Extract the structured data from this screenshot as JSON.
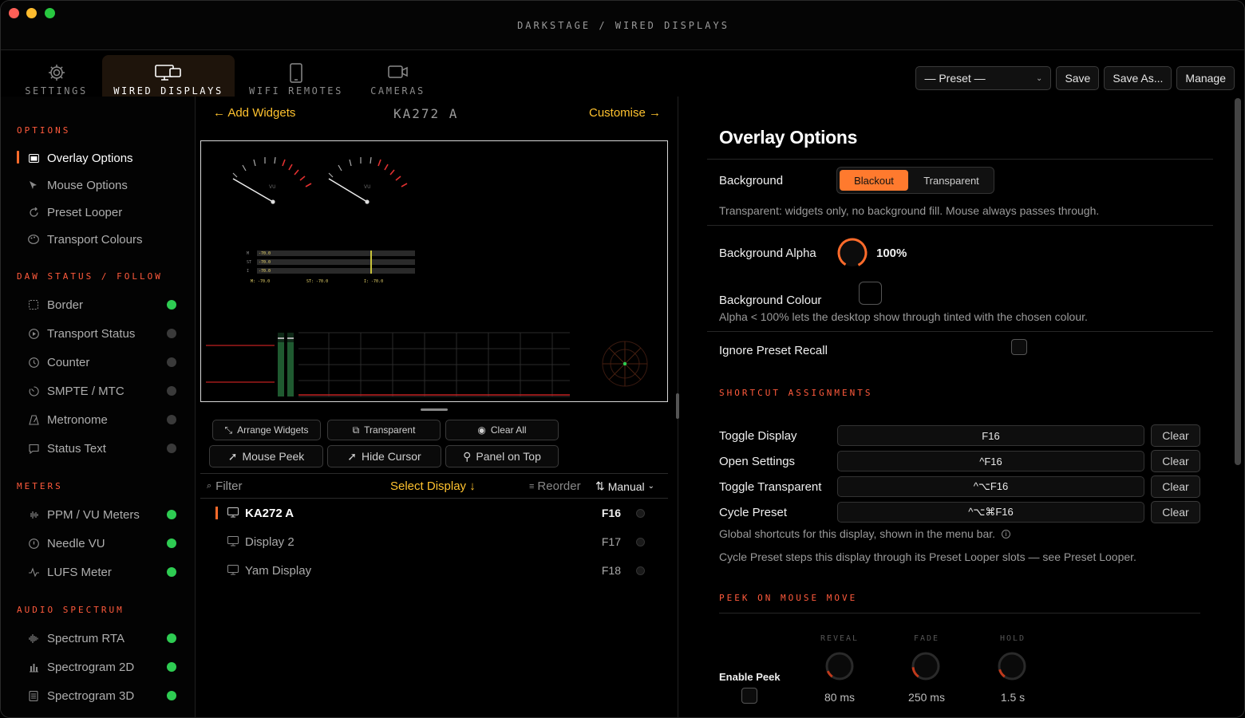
{
  "window": {
    "title": "DARKSTAGE / WIRED DISPLAYS"
  },
  "tabs": [
    {
      "label": "SETTINGS",
      "icon": "gear-icon"
    },
    {
      "label": "WIRED DISPLAYS",
      "icon": "monitor-icon"
    },
    {
      "label": "WIFI REMOTES",
      "icon": "tablet-icon"
    },
    {
      "label": "CAMERAS",
      "icon": "camera-icon"
    }
  ],
  "toolbar": {
    "preset": "— Preset —",
    "save": "Save",
    "save_as": "Save As...",
    "manage": "Manage"
  },
  "sidebar": {
    "options_title": "OPTIONS",
    "options": [
      "Overlay Options",
      "Mouse Options",
      "Preset Looper",
      "Transport Colours"
    ],
    "daw_title": "DAW STATUS / FOLLOW",
    "daw": [
      "Border",
      "Transport Status",
      "Counter",
      "SMPTE / MTC",
      "Metronome",
      "Status Text"
    ],
    "meters_title": "METERS",
    "meters": [
      "PPM / VU Meters",
      "Needle VU",
      "LUFS Meter"
    ],
    "spectrum_title": "AUDIO SPECTRUM",
    "spectrum": [
      "Spectrum RTA",
      "Spectrogram 2D",
      "Spectrogram 3D"
    ]
  },
  "middle": {
    "add_widgets": "← Add Widgets",
    "display_name": "KA272 A",
    "customise": "Customise →",
    "preview": {
      "vu_label": "VU",
      "lufs_rows": [
        "-70.0",
        "-70.0",
        "-70.0"
      ],
      "lufs_row_labels": [
        "M",
        "ST",
        "I"
      ],
      "lufs_footer": [
        "M: -70.0",
        "ST: -70.0",
        "I: -70.0"
      ]
    },
    "tools": {
      "arrange": "Arrange Widgets",
      "transparent": "Transparent",
      "clear_all": "Clear All",
      "mouse_peek": "Mouse Peek",
      "hide_cursor": "Hide Cursor",
      "panel_on_top": "Panel on Top"
    },
    "filter": "Filter",
    "select_display": "Select Display ↓",
    "reorder": "Reorder",
    "sort": "Manual",
    "displays": [
      {
        "name": "KA272 A",
        "key": "F16"
      },
      {
        "name": "Display 2",
        "key": "F17"
      },
      {
        "name": "Yam Display",
        "key": "F18"
      }
    ]
  },
  "overlay": {
    "title": "Overlay Options",
    "background_label": "Background",
    "bg_options": [
      "Blackout",
      "Transparent"
    ],
    "bg_note": "Transparent: widgets only, no background fill. Mouse always passes through.",
    "alpha_label": "Background Alpha",
    "alpha_value": "100%",
    "colour_label": "Background Colour",
    "colour_note": "Alpha < 100% lets the desktop show through tinted with the chosen colour.",
    "ignore_label": "Ignore Preset Recall",
    "shortcut_title": "SHORTCUT ASSIGNMENTS",
    "shortcuts": [
      {
        "label": "Toggle Display",
        "key": "F16"
      },
      {
        "label": "Open Settings",
        "key": "^F16"
      },
      {
        "label": "Toggle Transparent",
        "key": "^⌥F16"
      },
      {
        "label": "Cycle Preset",
        "key": "^⌥⌘F16"
      }
    ],
    "clear_label": "Clear",
    "shortcut_note": "Global shortcuts for this display, shown in the menu bar.",
    "cycle_note": "Cycle Preset steps this display through its Preset Looper slots — see Preset Looper.",
    "peek_title": "PEEK ON MOUSE MOVE",
    "enable_peek": "Enable Peek",
    "knobs": [
      {
        "label": "REVEAL",
        "value": "80 ms"
      },
      {
        "label": "FADE",
        "value": "250 ms"
      },
      {
        "label": "HOLD",
        "value": "1.5 s"
      }
    ]
  },
  "colors": {
    "accent": "#ff7a2e",
    "section": "#ff5a3c",
    "highlight": "#ffc22e",
    "on": "#2ecc52"
  }
}
